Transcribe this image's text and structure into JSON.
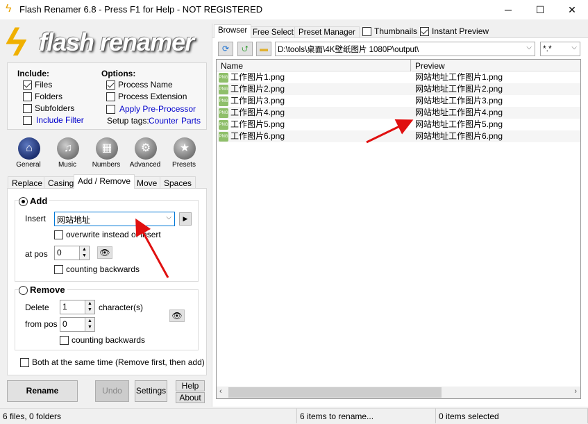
{
  "window": {
    "title": "Flash Renamer 6.8 - Press F1 for Help - NOT REGISTERED",
    "minimize": "─",
    "maximize": "☐",
    "close": "✕"
  },
  "logo": "flash renamer",
  "include": {
    "title": "Include:",
    "files": "Files",
    "folders": "Folders",
    "subfolders": "Subfolders",
    "include_filter": "Include Filter",
    "files_checked": true
  },
  "options": {
    "title": "Options:",
    "process_name": "Process Name",
    "process_extension": "Process Extension",
    "apply_preprocessor": "Apply Pre-Processor",
    "setup_tags": "Setup tags:",
    "counter": "Counter",
    "parts": "Parts",
    "process_name_checked": true
  },
  "categories": [
    {
      "label": "General",
      "icon": "home-icon"
    },
    {
      "label": "Music",
      "icon": "music-icon"
    },
    {
      "label": "Numbers",
      "icon": "calculator-icon"
    },
    {
      "label": "Advanced",
      "icon": "gear-icon"
    },
    {
      "label": "Presets",
      "icon": "star-icon"
    }
  ],
  "tabs": [
    "Replace",
    "Casing",
    "Add / Remove",
    "Move",
    "Spaces"
  ],
  "active_tab": "Add / Remove",
  "add": {
    "title": "Add",
    "insert_label": "Insert",
    "insert_value": "网站地址",
    "overwrite": "overwrite instead of insert",
    "at_pos_label": "at pos",
    "at_pos_value": "0",
    "counting_backwards": "counting backwards",
    "selected": true
  },
  "remove": {
    "title": "Remove",
    "delete_label": "Delete",
    "delete_value": "1",
    "characters": "character(s)",
    "from_pos_label": "from pos",
    "from_pos_value": "0",
    "counting_backwards": "counting backwards"
  },
  "both_label": "Both at the same time (Remove first, then add)",
  "buttons": {
    "rename": "Rename",
    "undo": "Undo",
    "settings": "Settings",
    "help": "Help",
    "about": "About"
  },
  "right_tabs": [
    "Browser",
    "Free Select",
    "Preset Manager"
  ],
  "thumbnails": "Thumbnails",
  "instant_preview": "Instant Preview",
  "path": "D:\\tools\\桌面\\4K壁纸图片 1080P\\output\\",
  "filter": "*.*",
  "columns": [
    "Name",
    "Preview"
  ],
  "files": [
    {
      "name": "工作图片1.png",
      "preview": "网站地址工作图片1.png"
    },
    {
      "name": "工作图片2.png",
      "preview": "网站地址工作图片2.png"
    },
    {
      "name": "工作图片3.png",
      "preview": "网站地址工作图片3.png"
    },
    {
      "name": "工作图片4.png",
      "preview": "网站地址工作图片4.png"
    },
    {
      "name": "工作图片5.png",
      "preview": "网站地址工作图片5.png"
    },
    {
      "name": "工作图片6.png",
      "preview": "网站地址工作图片6.png"
    }
  ],
  "status": {
    "files": "6 files, 0 folders",
    "to_rename": "6 items to rename...",
    "selected": "0 items selected"
  },
  "colors": {
    "link": "#0000cc",
    "arrow": "#e01010",
    "accent": "#1c2f6e"
  }
}
